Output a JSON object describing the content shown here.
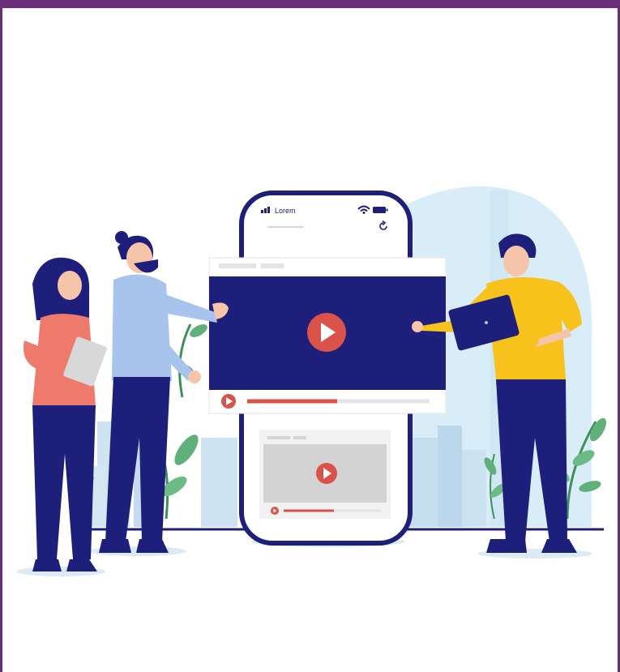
{
  "phone": {
    "status_label": "Lorem"
  },
  "colors": {
    "frame_border": "#6b2f7a",
    "navy": "#1e1f7a",
    "video_red": "#d9534a",
    "sky": "#d6ecf8",
    "shirt_yellow": "#f7c21c",
    "sweater_pink": "#ee7a6c",
    "shirt_lightblue": "#a7c4ec",
    "leaf_green": "#5fb07a"
  },
  "icons": {
    "signal": "signal-bars-icon",
    "wifi": "wifi-icon",
    "battery": "battery-icon",
    "refresh": "refresh-icon",
    "play": "play-icon"
  }
}
